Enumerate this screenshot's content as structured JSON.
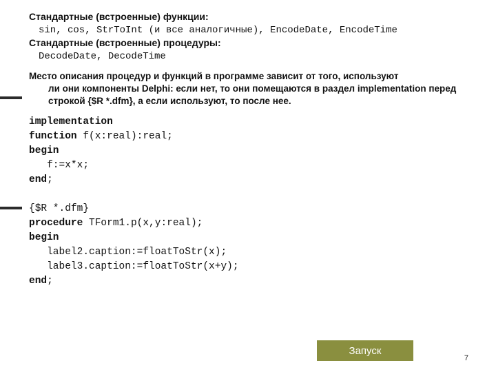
{
  "heading1": "Стандартные (встроенные) функции:",
  "funcs_line": "sin, cos, StrToInt (и все аналогичные), EncodeDate, EncodeTime",
  "heading2": "Стандартные (встроенные) процедуры:",
  "procs_line": "DecodeDate, DecodeTime",
  "para_first": "Место описания процедур и функций в программе зависит от того, используют",
  "para_rest": "ли они компоненты Delphi: если нет, то они помещаются в раздел implementation перед строкой {$R *.dfm}, а если используют, то после нее.",
  "code": {
    "l1_kw": "implementation",
    "l2_kw": "function",
    "l2_rest": " f(x:real):real;",
    "l3_kw": "begin",
    "l4": "   f:=x*x;",
    "l5_kw": "end",
    "l5_rest": ";",
    "blank": "",
    "l6": "{$R *.dfm}",
    "l7_kw": "procedure",
    "l7_rest": " TForm1.p(x,y:real);",
    "l8_kw": "begin",
    "l9": "   label2.caption:=floatToStr(x);",
    "l10": "   label3.caption:=floatToStr(x+y);",
    "l11_kw": "end",
    "l11_rest": ";"
  },
  "launch_label": "Запуск",
  "page_number": "7"
}
